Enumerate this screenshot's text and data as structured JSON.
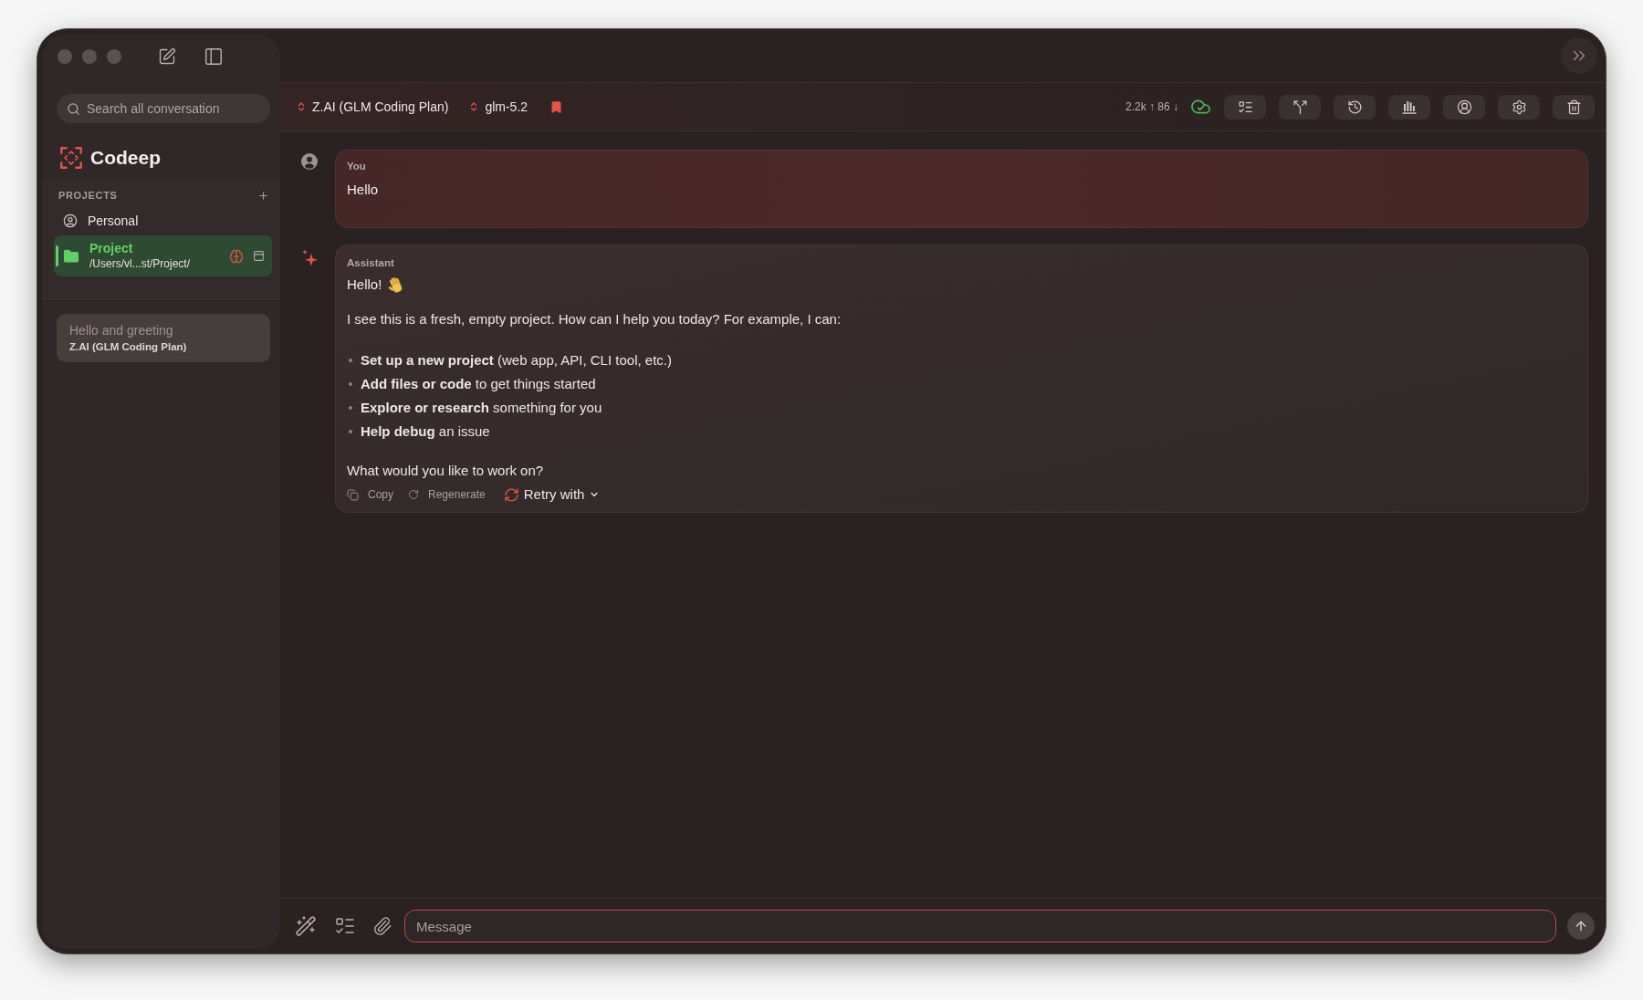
{
  "sidebar": {
    "search": {
      "placeholder": "Search all conversation"
    },
    "app_name": "Codeep",
    "projects": {
      "heading": "PROJECTS",
      "items": [
        {
          "kind": "personal",
          "name": "Personal",
          "selected": false
        },
        {
          "kind": "folder",
          "name": "Project",
          "path": "/Users/vl...st/Project/",
          "selected": true
        }
      ]
    },
    "conversations": [
      {
        "title": "Hello and greeting",
        "provider": "Z.AI (GLM Coding Plan)",
        "selected": true
      }
    ]
  },
  "toolbar": {
    "provider": "Z.AI (GLM Coding Plan)",
    "model": "glm-5.2",
    "tokens": "2.2k ↑ 86 ↓"
  },
  "messages": [
    {
      "kind": "user",
      "author": "You",
      "text": "Hello"
    },
    {
      "kind": "assistant",
      "author": "Assistant",
      "greeting": "Hello!",
      "intro": "I see this is a fresh, empty project. How can I help you today? For example, I can:",
      "bullets": [
        "**Set up a new project** (web app, API, CLI tool, etc.)",
        "**Add files or code** to get things started",
        "**Explore or research** something for you",
        "**Help debug** an issue"
      ],
      "closing": "What would you like to work on?",
      "actions": [
        {
          "kind": "copy",
          "label": "Copy"
        },
        {
          "kind": "regenerate",
          "label": "Regenerate"
        },
        {
          "kind": "retry",
          "label": "Retry with"
        }
      ]
    }
  ],
  "composer": {
    "placeholder": "Message"
  }
}
